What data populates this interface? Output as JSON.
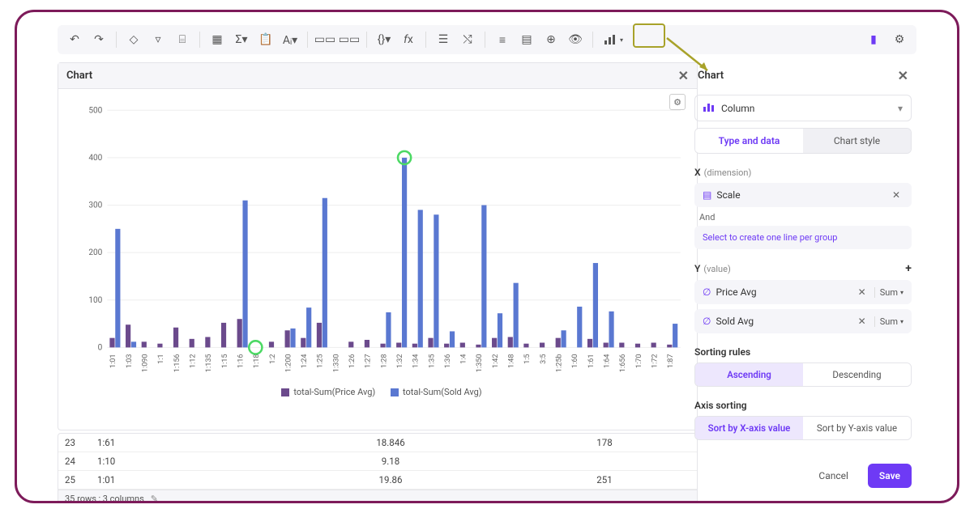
{
  "chart_panel_title": "Chart",
  "config_panel_title": "Chart",
  "chart_type": "Column",
  "tabs": {
    "type_data": "Type and data",
    "chart_style": "Chart style"
  },
  "x": {
    "label": "X",
    "sub": "(dimension)",
    "field": "Scale",
    "and": "And",
    "hint": "Select to create one line per group"
  },
  "y": {
    "label": "Y",
    "sub": "(value)",
    "series": [
      {
        "name": "Price Avg",
        "agg": "Sum"
      },
      {
        "name": "Sold Avg",
        "agg": "Sum"
      }
    ]
  },
  "sorting": {
    "rules_label": "Sorting rules",
    "asc": "Ascending",
    "desc": "Descending",
    "axis_label": "Axis sorting",
    "by_x": "Sort by X-axis value",
    "by_y": "Sort by Y-axis value"
  },
  "buttons": {
    "cancel": "Cancel",
    "save": "Save"
  },
  "table": {
    "rows": [
      {
        "idx": "23",
        "scale": "1:61",
        "price": "18.846",
        "sold": "178"
      },
      {
        "idx": "24",
        "scale": "1:10",
        "price": "9.18",
        "sold": ""
      },
      {
        "idx": "25",
        "scale": "1:01",
        "price": "19.86",
        "sold": "251"
      }
    ],
    "footer": "35 rows ; 3 columns"
  },
  "legend": {
    "series1": "total-Sum(Price Avg)",
    "series2": "total-Sum(Sold Avg)"
  },
  "colors": {
    "series1": "#6b4a8c",
    "series2": "#5a78d1",
    "accent": "#6e3af5",
    "highlight_ring": "#4cd964"
  },
  "chart_data": {
    "type": "bar",
    "title": "",
    "xlabel": "",
    "ylabel": "",
    "ylim": [
      0,
      500
    ],
    "yticks": [
      0,
      100,
      200,
      300,
      400,
      500
    ],
    "categories": [
      "1:01",
      "1:03",
      "1:090",
      "1:1",
      "1:156",
      "1:12",
      "1:135",
      "1:15",
      "1:16",
      "1:18",
      "1:2",
      "1:200",
      "1:24",
      "1:25",
      "1:330",
      "1:26",
      "1:27",
      "1:28",
      "1:32",
      "1:34",
      "1:35",
      "1:36",
      "1:4",
      "1:350",
      "1:42",
      "1:48",
      "1:5",
      "3:5",
      "1:25b",
      "1:60",
      "1:61",
      "1:64",
      "1:656",
      "1:70",
      "1:72",
      "1:87"
    ],
    "series": [
      {
        "name": "total-Sum(Price Avg)",
        "values": [
          20,
          48,
          12,
          8,
          42,
          18,
          22,
          52,
          60,
          0,
          12,
          36,
          20,
          52,
          0,
          12,
          16,
          8,
          10,
          8,
          20,
          8,
          10,
          6,
          20,
          22,
          8,
          10,
          20,
          0,
          18,
          10,
          10,
          8,
          10,
          6
        ]
      },
      {
        "name": "total-Sum(Sold Avg)",
        "values": [
          250,
          12,
          0,
          0,
          0,
          0,
          0,
          0,
          310,
          0,
          0,
          40,
          84,
          315,
          0,
          0,
          0,
          74,
          400,
          290,
          280,
          34,
          0,
          300,
          72,
          136,
          0,
          0,
          36,
          86,
          178,
          76,
          0,
          0,
          0,
          50
        ]
      }
    ],
    "highlights": [
      {
        "category": "1:18",
        "series": 0,
        "note": "circled"
      },
      {
        "category": "1:32",
        "series": 1,
        "note": "circled"
      }
    ]
  }
}
